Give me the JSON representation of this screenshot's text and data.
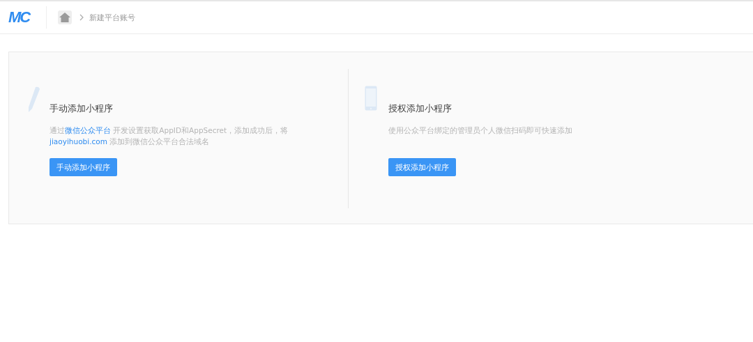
{
  "header": {
    "logo": "MC",
    "breadcrumb": [
      {
        "label": "新建平台账号"
      }
    ]
  },
  "options": [
    {
      "kind": "manual",
      "title": "手动添加小程序",
      "description": [
        {
          "text": "通过",
          "kind": "plain"
        },
        {
          "text": "微信公众平台",
          "kind": "link"
        },
        {
          "text": " 开发设置获取AppID和AppSecret，添加成功后，将 ",
          "kind": "plain"
        },
        {
          "text": "jiaoyihuobi.com",
          "kind": "link"
        },
        {
          "text": " 添加到微信公众平台合法域名",
          "kind": "plain"
        }
      ],
      "button": "手动添加小程序"
    },
    {
      "kind": "authorize",
      "title": "授权添加小程序",
      "description": [
        {
          "text": "使用公众平台绑定的管理员个人微信扫码即可快速添加",
          "kind": "plain"
        }
      ],
      "button": "授权添加小程序"
    }
  ]
}
